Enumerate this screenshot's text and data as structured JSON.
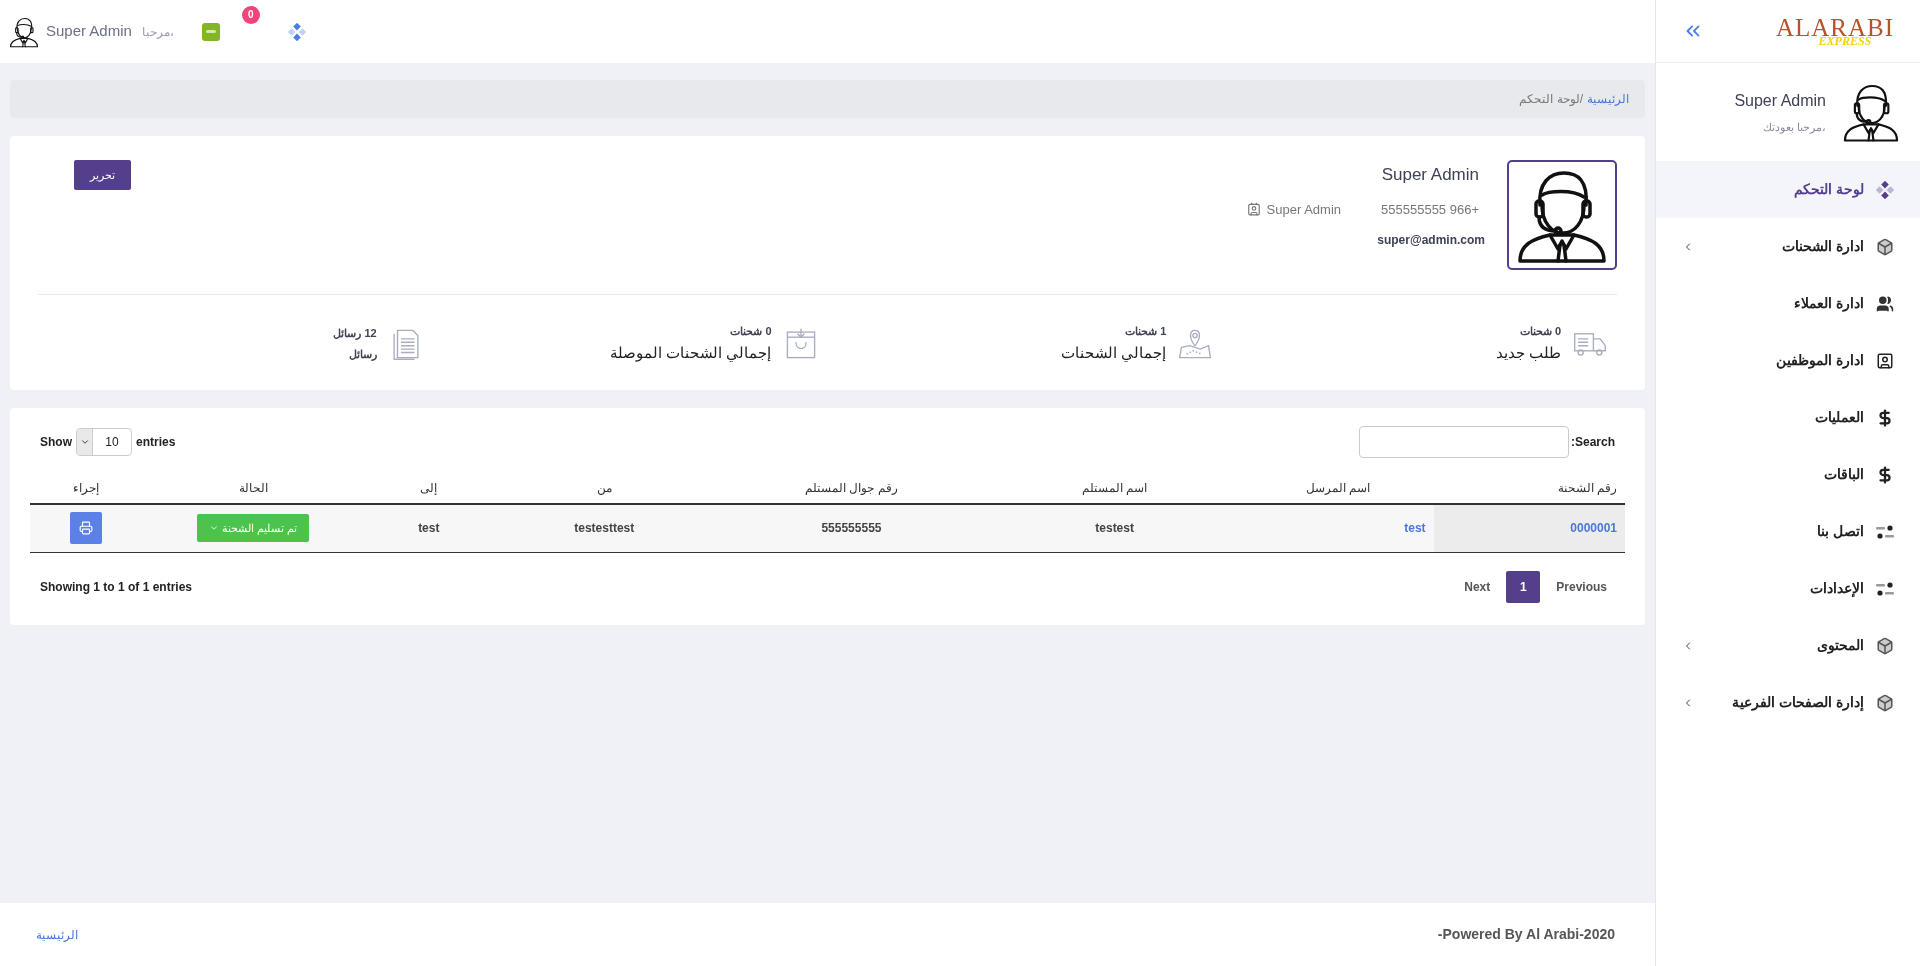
{
  "header": {
    "greeting": "مرحبا،",
    "user_name": "Super Admin",
    "notification_count": "0"
  },
  "sidebar": {
    "logo": {
      "title": "ALARABI",
      "subtitle": "EXPRESS"
    },
    "user": {
      "name": "Super Admin",
      "welcome": "مرحبا بعودتك،"
    },
    "items": [
      {
        "kind": "dashboard",
        "label": "لوحة التحكم",
        "selected": true,
        "expandable": false
      },
      {
        "kind": "cube",
        "label": "ادارة الشحنات",
        "selected": false,
        "expandable": true
      },
      {
        "kind": "users",
        "label": "ادارة العملاء",
        "selected": false,
        "expandable": false
      },
      {
        "kind": "contact",
        "label": "ادارة الموظفين",
        "selected": false,
        "expandable": false
      },
      {
        "kind": "dollar",
        "label": "العمليات",
        "selected": false,
        "expandable": false
      },
      {
        "kind": "dollar",
        "label": "الباقات",
        "selected": false,
        "expandable": false
      },
      {
        "kind": "toggles",
        "label": "اتصل بنا",
        "selected": false,
        "expandable": false
      },
      {
        "kind": "toggles",
        "label": "الإعدادات",
        "selected": false,
        "expandable": false
      },
      {
        "kind": "cube",
        "label": "المحتوى",
        "selected": false,
        "expandable": true
      },
      {
        "kind": "cube",
        "label": "إدارة الصفحات الفرعية",
        "selected": false,
        "expandable": true
      }
    ]
  },
  "breadcrumb": [
    {
      "label": "الرئيسية",
      "link": true
    },
    {
      "label": "/لوحة التحكم",
      "link": false
    }
  ],
  "profile": {
    "name": "Super Admin",
    "phone": "555555555 966+",
    "role": "Super Admin",
    "email": "super@admin.com",
    "edit_button": "تحرير"
  },
  "stats": [
    {
      "kind": "truck",
      "count": "0 شحنات",
      "label": "طلب جديد"
    },
    {
      "kind": "map",
      "count": "1 شحنات",
      "label": "إجمالي الشحنات"
    },
    {
      "kind": "bag",
      "count": "0 شحنات",
      "label": "إجمالي الشحنات الموصلة"
    },
    {
      "kind": "document",
      "count": "12 رسائل",
      "label": "رسائل"
    }
  ],
  "table": {
    "show_label": "Show",
    "page_size": "10",
    "entries_label": "entries",
    "search_label": ":Search",
    "columns": [
      "رقم الشحنة",
      "اسم المرسل",
      "اسم المستلم",
      "رقم جوال المستلم",
      "من",
      "إلى",
      "الحالة",
      "إجراء"
    ],
    "rows": [
      {
        "shipment_number": "0000001",
        "sender": "test",
        "recipient": "testest",
        "recipient_phone": "555555555",
        "from": "testesttest",
        "to": "test",
        "status": "تم تسليم الشحنة"
      }
    ],
    "info": "Showing 1 to 1 of 1 entries",
    "pagination": {
      "previous": "Previous",
      "pages": [
        {
          "label": "1",
          "selected": true
        }
      ],
      "next": "Next"
    }
  },
  "footer": {
    "link": "الرئيسية",
    "copyright": "-Powered By Al Arabi-2020"
  }
}
